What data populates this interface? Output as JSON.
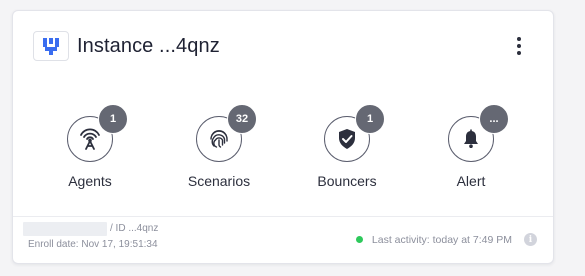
{
  "instance": {
    "title": "Instance ...4qnz",
    "logo_icon": "crowdsec-logo-icon",
    "menu_icon": "kebab-menu-icon"
  },
  "stats": [
    {
      "label": "Agents",
      "count": "1",
      "icon": "antenna-icon"
    },
    {
      "label": "Scenarios",
      "count": "32",
      "icon": "fingerprint-icon"
    },
    {
      "label": "Bouncers",
      "count": "1",
      "icon": "shield-check-icon"
    },
    {
      "label": "Alert",
      "count": "...",
      "icon": "bell-icon"
    }
  ],
  "footer": {
    "id_text": "/ ID ...4qnz",
    "enroll_date": "Enroll date: Nov 17, 19:51:34",
    "last_activity": "Last activity: today at 7:49 PM",
    "status_color": "#2ec95c"
  },
  "colors": {
    "badge": "#656873",
    "logo_blue": "#3a6df0",
    "text": "#1f2233"
  }
}
